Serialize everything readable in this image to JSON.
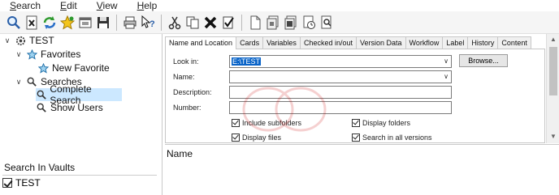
{
  "menu": {
    "items": [
      {
        "label": "Search",
        "accel": "S"
      },
      {
        "label": "Edit",
        "accel": "E"
      },
      {
        "label": "View",
        "accel": "V"
      },
      {
        "label": "Help",
        "accel": "H"
      }
    ]
  },
  "tree": {
    "root": "TEST",
    "favorites": "Favorites",
    "new_favorite": "New Favorite",
    "searches": "Searches",
    "complete_search": "Complete Search",
    "show_users": "Show Users"
  },
  "vaults": {
    "header": "Search In Vaults",
    "items": [
      {
        "label": "TEST",
        "checked": true
      }
    ]
  },
  "tabs": [
    "Name and Location",
    "Cards",
    "Variables",
    "Checked in/out",
    "Version Data",
    "Workflow",
    "Label",
    "History",
    "Content"
  ],
  "form": {
    "look_in_label": "Look in:",
    "look_in_value": "E:\\TEST",
    "name_label": "Name:",
    "description_label": "Description:",
    "number_label": "Number:",
    "browse_label": "Browse..."
  },
  "options": {
    "include_subfolders": {
      "label": "Include subfolders",
      "checked": true
    },
    "display_folders": {
      "label": "Display folders",
      "checked": true
    },
    "display_files": {
      "label": "Display files",
      "checked": true
    },
    "search_all_versions": {
      "label": "Search in all versions",
      "checked": true
    }
  },
  "results": {
    "columns": [
      "Name"
    ]
  },
  "colors": {
    "selection": "#cce8ff",
    "highlight": "#0a64c8"
  }
}
